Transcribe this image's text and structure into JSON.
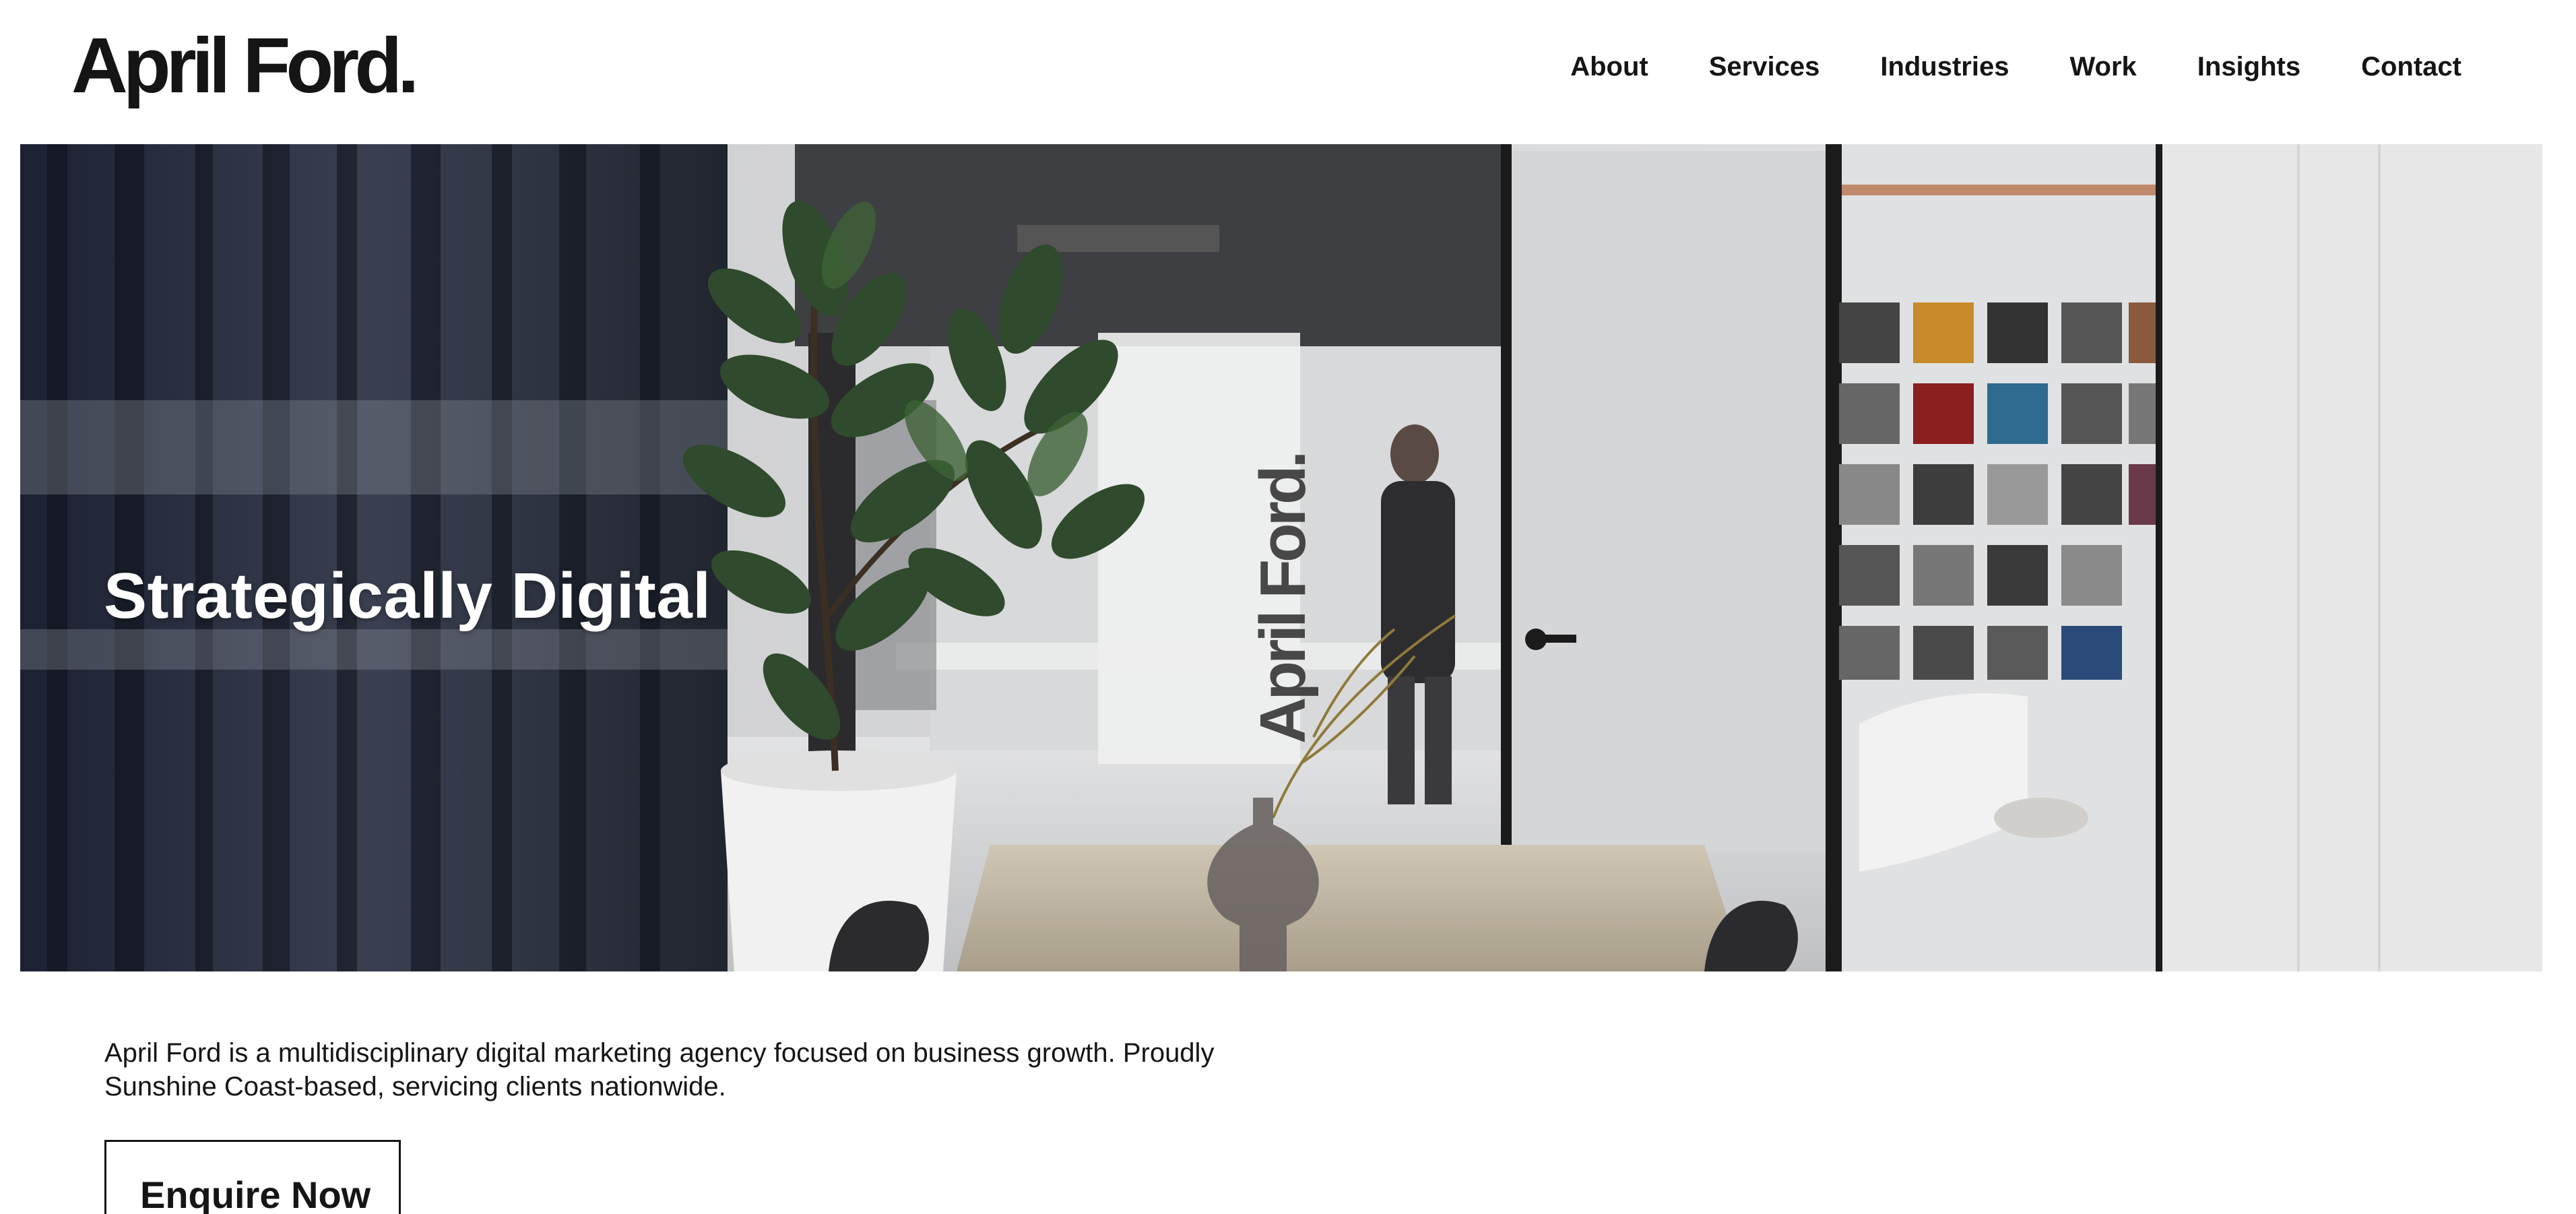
{
  "header": {
    "logo": "April Ford.",
    "nav": [
      "About",
      "Services",
      "Industries",
      "Work",
      "Insights",
      "Contact"
    ]
  },
  "hero": {
    "title": "Strategically Digital",
    "wall_brand": "April Ford."
  },
  "intro": {
    "text": "April Ford is a multidisciplinary digital marketing agency focused on business growth. Proudly Sunshine Coast-based, servicing clients nationwide.",
    "cta_label": "Enquire Now"
  }
}
